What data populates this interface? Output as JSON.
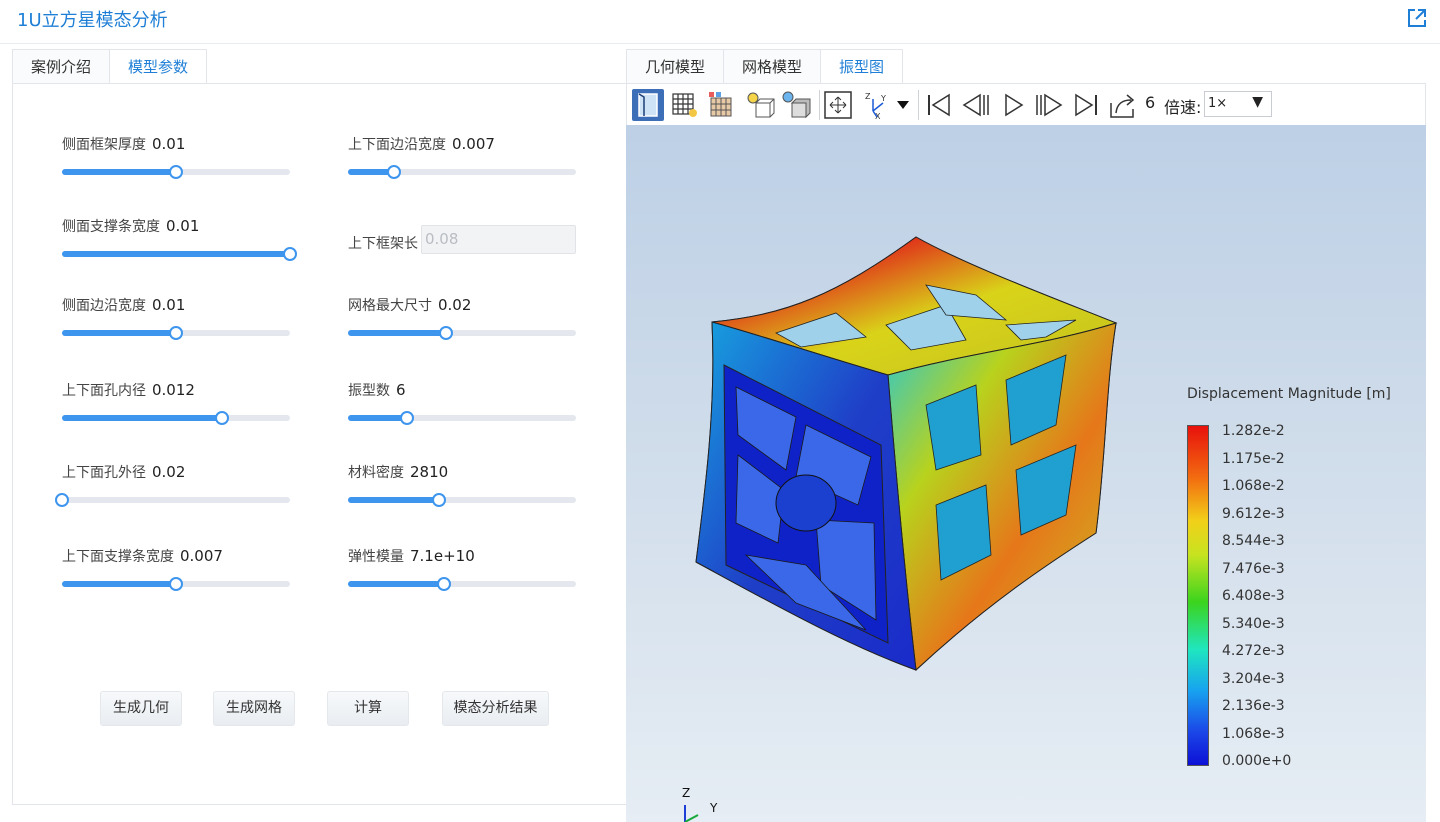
{
  "app": {
    "title": "1U立方星模态分析"
  },
  "left": {
    "tabs": [
      {
        "label": "案例介绍",
        "active": false
      },
      {
        "label": "模型参数",
        "active": true
      }
    ],
    "params": [
      {
        "label": "侧面框架厚度",
        "value": "0.01",
        "position": 0.5
      },
      {
        "label": "上下面边沿宽度",
        "value": "0.007",
        "position": 0.2
      },
      {
        "label": "侧面支撑条宽度",
        "value": "0.01",
        "position": 1.0
      },
      {
        "label": "上下框架长",
        "value": "0.08"
      },
      {
        "label": "侧面边沿宽度",
        "value": "0.01",
        "position": 0.5
      },
      {
        "label": "网格最大尺寸",
        "value": "0.02",
        "position": 0.43
      },
      {
        "label": "上下面孔内径",
        "value": "0.012",
        "position": 0.7
      },
      {
        "label": "振型数",
        "value": "6",
        "position": 0.26
      },
      {
        "label": "上下面孔外径",
        "value": "0.02",
        "position": 0.0
      },
      {
        "label": "材料密度",
        "value": "2810",
        "position": 0.4
      },
      {
        "label": "上下面支撑条宽度",
        "value": "0.007",
        "position": 0.5
      },
      {
        "label": "弹性模量",
        "value": "7.1e+10",
        "position": 0.42
      }
    ],
    "buttons": {
      "gen_geometry": "生成几何",
      "gen_mesh": "生成网格",
      "compute": "计算",
      "modal_result": "模态分析结果"
    }
  },
  "right": {
    "tabs": [
      {
        "label": "几何模型",
        "active": false
      },
      {
        "label": "网格模型",
        "active": false
      },
      {
        "label": "振型图",
        "active": true
      }
    ],
    "toolbar": {
      "frame": "6",
      "speed_label": "倍速:",
      "speed_value": "1×",
      "icons": [
        "surface-view-icon",
        "wireframe-view-icon",
        "mesh-colored-icon",
        "light-box-icon",
        "light-shaded-icon",
        "fit-view-icon",
        "axes-orientation-icon",
        "first-frame-icon",
        "prev-frame-icon",
        "play-icon",
        "next-frame-icon",
        "last-frame-icon",
        "export-icon"
      ]
    },
    "legend": {
      "title": "Displacement Magnitude [m]",
      "labels": [
        "1.282e-2",
        "1.175e-2",
        "1.068e-2",
        "9.612e-3",
        "8.544e-3",
        "7.476e-3",
        "6.408e-3",
        "5.340e-3",
        "4.272e-3",
        "3.204e-3",
        "2.136e-3",
        "1.068e-3",
        "0.000e+0"
      ]
    },
    "axes": {
      "z": "Z",
      "y": "Y"
    }
  }
}
